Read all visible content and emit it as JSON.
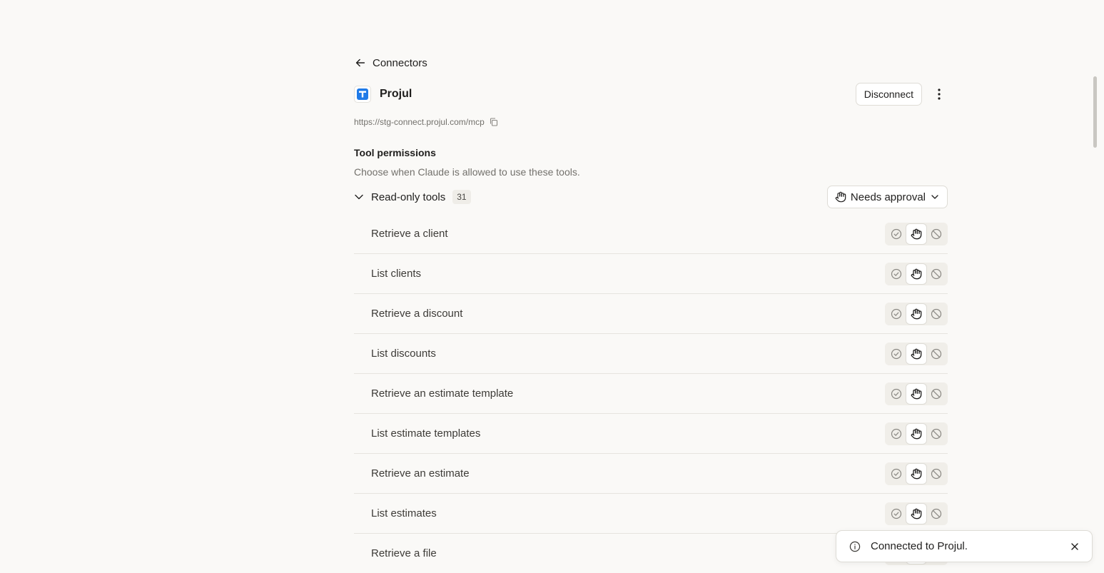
{
  "nav": {
    "back_label": "Connectors"
  },
  "app": {
    "title": "Projul",
    "url": "https://stg-connect.projul.com/mcp",
    "disconnect_label": "Disconnect"
  },
  "permissions": {
    "title": "Tool permissions",
    "description": "Choose when Claude is allowed to use these tools."
  },
  "group": {
    "label": "Read-only tools",
    "count": "31",
    "dropdown_label": "Needs approval"
  },
  "tools": [
    {
      "name": "Retrieve a client"
    },
    {
      "name": "List clients"
    },
    {
      "name": "Retrieve a discount"
    },
    {
      "name": "List discounts"
    },
    {
      "name": "Retrieve an estimate template"
    },
    {
      "name": "List estimate templates"
    },
    {
      "name": "Retrieve an estimate"
    },
    {
      "name": "List estimates"
    },
    {
      "name": "Retrieve a file"
    }
  ],
  "toast": {
    "message": "Connected to Projul."
  },
  "colors": {
    "background": "#faf9f7",
    "brand": "#1f7ae8",
    "text": "#1f1e1d",
    "muted": "#73716c"
  },
  "icons": {
    "back": "arrow-left-icon",
    "copy": "copy-icon",
    "more": "kebab-icon",
    "allow": "check-circle-icon",
    "approval": "hand-icon",
    "block": "block-icon",
    "chevron": "chevron-down-icon",
    "info": "info-icon",
    "close": "close-icon"
  }
}
